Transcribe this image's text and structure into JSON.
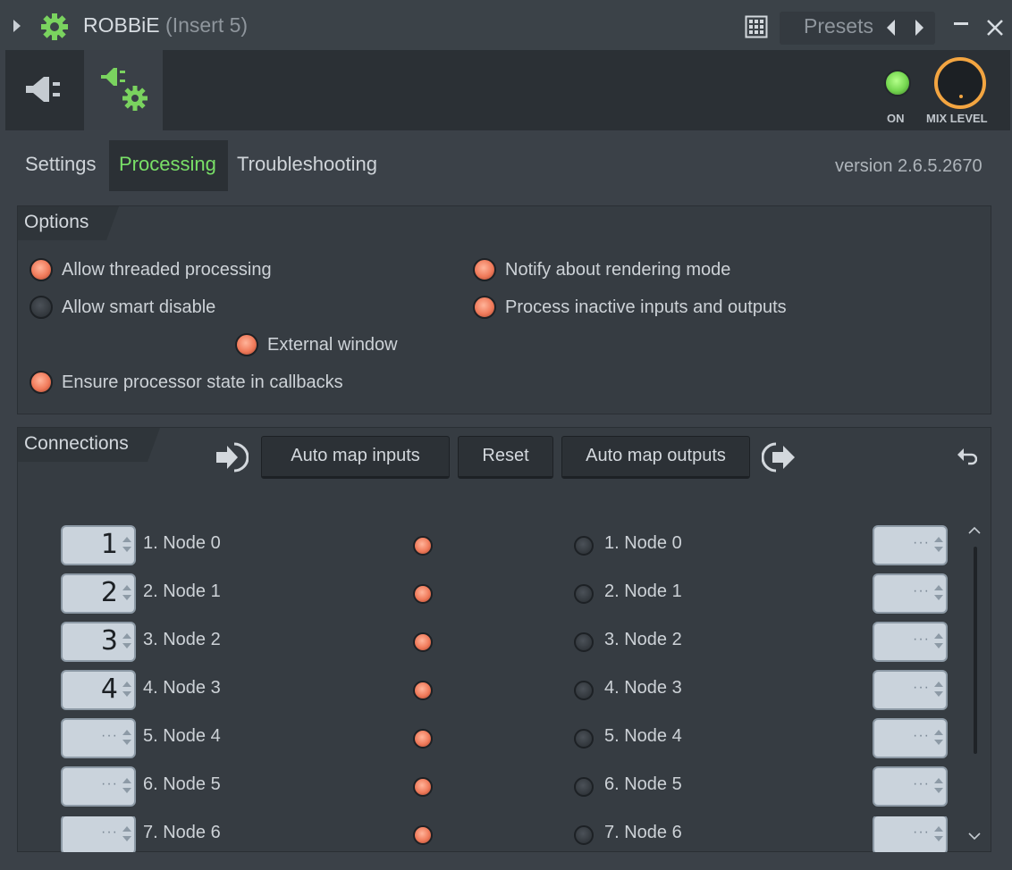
{
  "window": {
    "title": "ROBBiE",
    "insert": "(Insert 5)",
    "presets_label": "Presets"
  },
  "header": {
    "on_label": "ON",
    "mix_label": "MIX LEVEL"
  },
  "tabs": [
    {
      "label": "Settings",
      "active": false
    },
    {
      "label": "Processing",
      "active": true
    },
    {
      "label": "Troubleshooting",
      "active": false
    }
  ],
  "version": "version 2.6.5.2670",
  "options": {
    "title": "Options",
    "items": [
      {
        "label": "Allow threaded processing",
        "checked": true
      },
      {
        "label": "Notify about rendering mode",
        "checked": true
      },
      {
        "label": "Allow smart disable",
        "checked": false
      },
      {
        "label": "Process inactive inputs and outputs",
        "checked": true
      },
      {
        "label": "External window",
        "checked": true
      },
      {
        "label": "Ensure processor state in callbacks",
        "checked": true
      }
    ]
  },
  "connections": {
    "title": "Connections",
    "auto_map_inputs": "Auto map inputs",
    "reset": "Reset",
    "auto_map_outputs": "Auto map outputs",
    "inputs": [
      {
        "value": "1",
        "label": "1. Node 0"
      },
      {
        "value": "2",
        "label": "2. Node 1"
      },
      {
        "value": "3",
        "label": "3. Node 2"
      },
      {
        "value": "4",
        "label": "4. Node 3"
      },
      {
        "value": "···",
        "label": "5. Node 4"
      },
      {
        "value": "···",
        "label": "6. Node 5"
      },
      {
        "value": "···",
        "label": "7. Node 6"
      }
    ],
    "outputs": [
      {
        "value": "···",
        "label": "1. Node 0"
      },
      {
        "value": "···",
        "label": "2. Node 1"
      },
      {
        "value": "···",
        "label": "3. Node 2"
      },
      {
        "value": "···",
        "label": "4. Node 3"
      },
      {
        "value": "···",
        "label": "5. Node 4"
      },
      {
        "value": "···",
        "label": "6. Node 5"
      },
      {
        "value": "···",
        "label": "7. Node 6"
      }
    ]
  },
  "colors": {
    "accent_green": "#79e067",
    "led_on": "#f07a5a",
    "knob_ring": "#f3a541"
  }
}
